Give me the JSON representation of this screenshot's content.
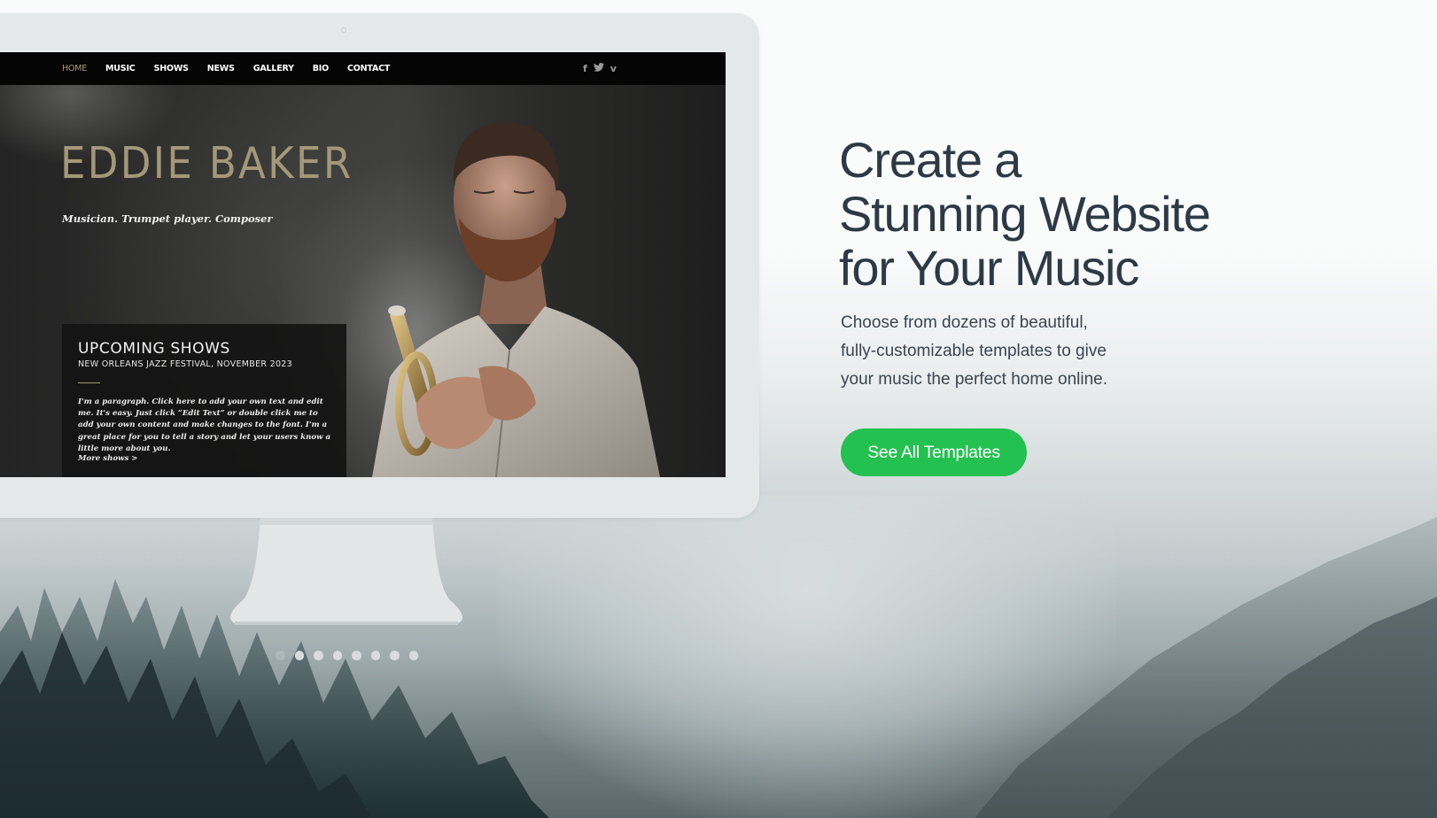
{
  "hero": {
    "headline_lines": [
      "Create a",
      "Stunning Website",
      "for Your Music"
    ],
    "subcopy_lines": [
      "Choose from dozens of beautiful,",
      "fully-customizable templates to give",
      "your music the perfect home online."
    ],
    "cta_label": "See All Templates",
    "cta_color": "#23c150"
  },
  "template_preview": {
    "nav": {
      "items": [
        "HOME",
        "MUSIC",
        "SHOWS",
        "NEWS",
        "GALLERY",
        "BIO",
        "CONTACT"
      ],
      "active": "HOME",
      "social_icons": [
        {
          "name": "facebook-icon",
          "glyph": "f"
        },
        {
          "name": "twitter-icon",
          "glyph": "t"
        },
        {
          "name": "vimeo-icon",
          "glyph": "v"
        }
      ]
    },
    "artist_name": "EDDIE BAKER",
    "artist_tagline": "Musician. Trumpet player. Composer",
    "shows": {
      "title": "UPCOMING SHOWS",
      "subtitle": "NEW ORLEANS JAZZ FESTIVAL, NOVEMBER 2023",
      "body": "I'm a paragraph. Click here to add your own text and edit me. It's easy. Just click “Edit Text” or double click me to add your own content and make changes to the font. I'm a great place for you to tell a story and let your users know a little more about you.",
      "more_link": "More shows >"
    },
    "accent_color": "#a39877"
  },
  "carousel": {
    "total_dots": 8,
    "active_index": 0
  }
}
